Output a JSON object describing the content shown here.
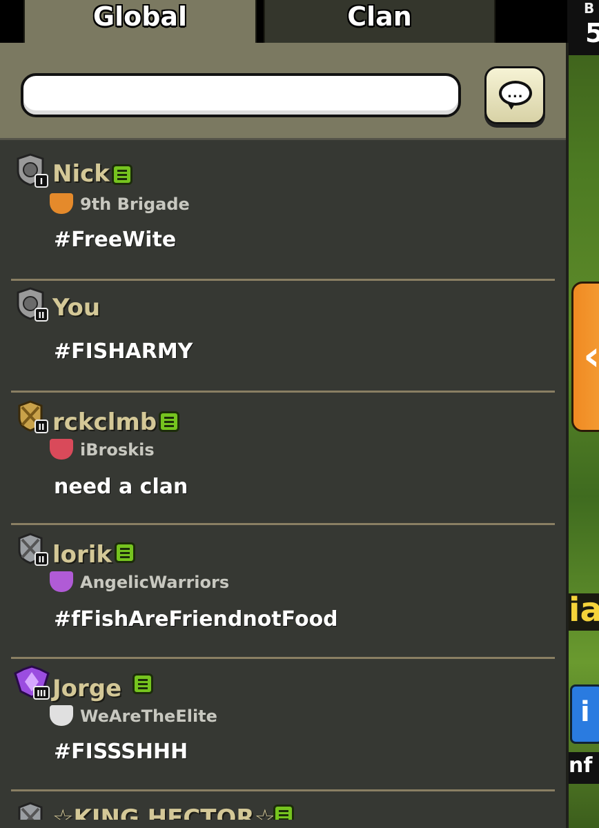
{
  "tabs": [
    {
      "label": "Global",
      "active": true
    },
    {
      "label": "Clan",
      "active": false
    }
  ],
  "input": {
    "value": "",
    "placeholder": ""
  },
  "send_button": {
    "icon": "chat-bubble-icon",
    "label": "..."
  },
  "game_side": {
    "top_small": "B",
    "top_big": "5",
    "yellow_label": "ia",
    "info_label": "nf"
  },
  "messages": [
    {
      "name": "Nick",
      "rank_icon": "silver-shield-icon",
      "rank_level": "I",
      "clan_name": "9th Brigade",
      "clan_color": "#e58a2b",
      "has_badge": true,
      "text": "#FreeWite"
    },
    {
      "name": "You",
      "rank_icon": "silver-shield-icon",
      "rank_level": "II",
      "clan_name": "",
      "has_badge": false,
      "text": "#FISHARMY"
    },
    {
      "name": "rckclmb",
      "rank_icon": "gold-swords-icon",
      "rank_level": "II",
      "clan_name": "iBroskis",
      "clan_color": "#d94a5a",
      "has_badge": true,
      "text": "need a clan"
    },
    {
      "name": "lorik",
      "rank_icon": "silver-swords-icon",
      "rank_level": "II",
      "clan_name": "AngelicWarriors",
      "clan_color": "#b05bd6",
      "has_badge": true,
      "text": "#fFishAreFriendnotFood"
    },
    {
      "name": "Jorge",
      "rank_icon": "purple-crystal-icon",
      "rank_level": "III",
      "clan_name": "WeAreTheElite",
      "clan_color": "#e0e0e0",
      "has_badge": true,
      "text": "#FISSSHHH"
    },
    {
      "name": "☆KING HECTOR☆",
      "rank_icon": "silver-swords-icon",
      "rank_level": "",
      "clan_name": "",
      "has_badge": true,
      "text": ""
    }
  ],
  "colors": {
    "panel": "#363833",
    "header": "#7b7961",
    "name": "#d4c897",
    "divider": "#8a7f63",
    "badge": "#76c41f"
  }
}
